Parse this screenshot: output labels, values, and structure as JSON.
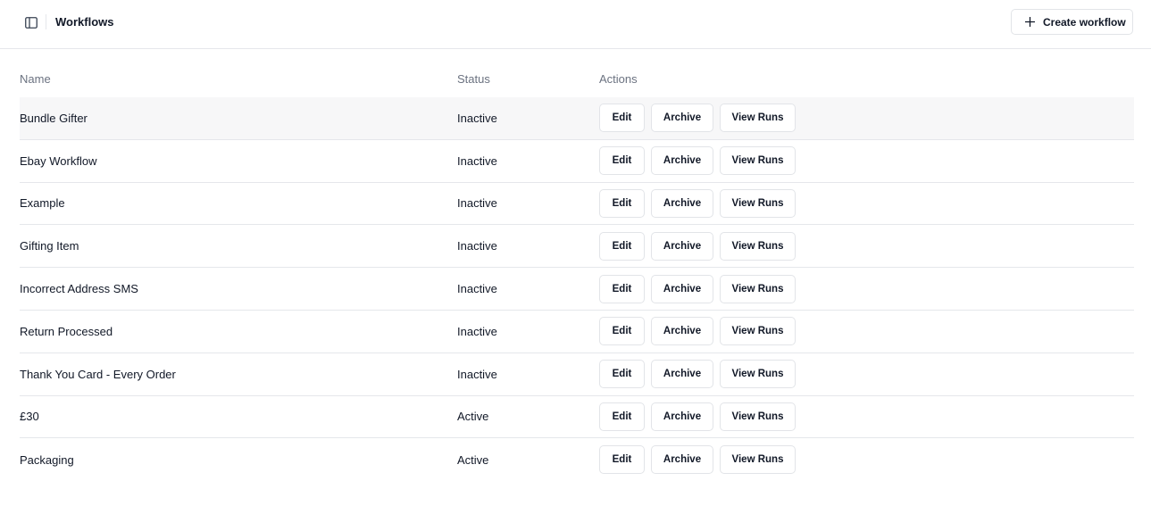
{
  "header": {
    "title": "Workflows",
    "toggle_icon": "sidebar-panel-icon",
    "create_button": {
      "label": "Create workflow",
      "icon": "plus-icon"
    }
  },
  "table": {
    "columns": [
      "Name",
      "Status",
      "Actions"
    ],
    "action_labels": {
      "edit": "Edit",
      "archive": "Archive",
      "view_runs": "View Runs"
    },
    "rows": [
      {
        "name": "Bundle Gifter",
        "status": "Inactive"
      },
      {
        "name": "Ebay Workflow",
        "status": "Inactive"
      },
      {
        "name": "Example",
        "status": "Inactive"
      },
      {
        "name": "Gifting Item",
        "status": "Inactive"
      },
      {
        "name": "Incorrect Address SMS",
        "status": "Inactive"
      },
      {
        "name": "Return Processed",
        "status": "Inactive"
      },
      {
        "name": "Thank You Card - Every Order",
        "status": "Inactive"
      },
      {
        "name": "£30",
        "status": "Active"
      },
      {
        "name": "Packaging",
        "status": "Active"
      }
    ]
  }
}
